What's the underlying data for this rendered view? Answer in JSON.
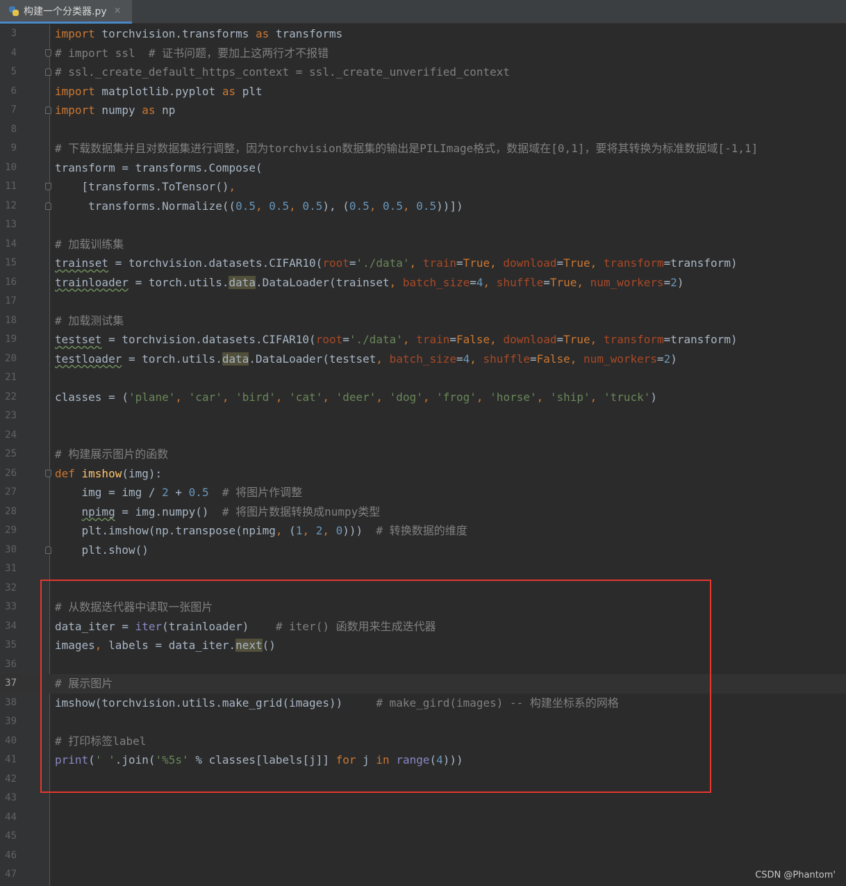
{
  "tab": {
    "label": "构建一个分类器.py",
    "close": "×"
  },
  "editor": {
    "current_line": "37",
    "lines": [
      {
        "n": "3",
        "f": "",
        "t": [
          [
            "kw",
            "import"
          ],
          [
            "",
            " torchvision.transforms "
          ],
          [
            "kw",
            "as"
          ],
          [
            "",
            " transforms"
          ]
        ]
      },
      {
        "n": "4",
        "f": "s",
        "t": [
          [
            "cm",
            "# import ssl  # 证书问题，要加上这两行才不报错"
          ]
        ]
      },
      {
        "n": "5",
        "f": "e",
        "t": [
          [
            "cm",
            "# ssl._create_default_https_context = ssl._create_unverified_context"
          ]
        ]
      },
      {
        "n": "6",
        "f": "",
        "t": [
          [
            "kw",
            "import"
          ],
          [
            "",
            " matplotlib.pyplot "
          ],
          [
            "kw",
            "as"
          ],
          [
            "",
            " plt"
          ]
        ]
      },
      {
        "n": "7",
        "f": "e",
        "t": [
          [
            "kw",
            "import"
          ],
          [
            "",
            " numpy "
          ],
          [
            "kw",
            "as"
          ],
          [
            "",
            " np"
          ]
        ]
      },
      {
        "n": "8",
        "f": "",
        "t": []
      },
      {
        "n": "9",
        "f": "",
        "t": [
          [
            "cm",
            "# 下载数据集并且对数据集进行调整，因为torchvision数据集的输出是PILImage格式，数据域在[0,1]，要将其转换为标准数据域[-1,1]"
          ]
        ]
      },
      {
        "n": "10",
        "f": "",
        "t": [
          [
            "",
            "transform = transforms.Compose("
          ]
        ]
      },
      {
        "n": "11",
        "f": "s",
        "t": [
          [
            "",
            "    [transforms.ToTensor()"
          ],
          [
            "kwc",
            ","
          ]
        ]
      },
      {
        "n": "12",
        "f": "e",
        "t": [
          [
            "",
            "     transforms.Normalize(("
          ],
          [
            "num",
            "0.5"
          ],
          [
            "kwc",
            ", "
          ],
          [
            "num",
            "0.5"
          ],
          [
            "kwc",
            ", "
          ],
          [
            "num",
            "0.5"
          ],
          [
            "",
            "), ("
          ],
          [
            "num",
            "0.5"
          ],
          [
            "kwc",
            ", "
          ],
          [
            "num",
            "0.5"
          ],
          [
            "kwc",
            ", "
          ],
          [
            "num",
            "0.5"
          ],
          [
            "",
            "))])"
          ]
        ]
      },
      {
        "n": "13",
        "f": "",
        "t": []
      },
      {
        "n": "14",
        "f": "",
        "t": [
          [
            "cm",
            "# 加载训练集"
          ]
        ]
      },
      {
        "n": "15",
        "f": "",
        "t": [
          [
            "wavy",
            "trainset"
          ],
          [
            "",
            " = torchvision.datasets.CIFAR10("
          ],
          [
            "param",
            "root"
          ],
          [
            "",
            "="
          ],
          [
            "str",
            "'./data'"
          ],
          [
            "kwc",
            ", "
          ],
          [
            "param",
            "train"
          ],
          [
            "",
            "="
          ],
          [
            "kw",
            "True"
          ],
          [
            "kwc",
            ", "
          ],
          [
            "param",
            "download"
          ],
          [
            "",
            "="
          ],
          [
            "kw",
            "True"
          ],
          [
            "kwc",
            ", "
          ],
          [
            "param",
            "transform"
          ],
          [
            "",
            "=transform)"
          ]
        ]
      },
      {
        "n": "16",
        "f": "",
        "t": [
          [
            "wavy",
            "trainloader"
          ],
          [
            "",
            " = torch.utils."
          ],
          [
            "hl",
            "data"
          ],
          [
            "",
            ".DataLoader(trainset"
          ],
          [
            "kwc",
            ", "
          ],
          [
            "param",
            "batch_size"
          ],
          [
            "",
            "="
          ],
          [
            "num",
            "4"
          ],
          [
            "kwc",
            ", "
          ],
          [
            "param",
            "shuffle"
          ],
          [
            "",
            "="
          ],
          [
            "kw",
            "True"
          ],
          [
            "kwc",
            ", "
          ],
          [
            "param",
            "num_workers"
          ],
          [
            "",
            "="
          ],
          [
            "num",
            "2"
          ],
          [
            "",
            ")"
          ]
        ]
      },
      {
        "n": "17",
        "f": "",
        "t": []
      },
      {
        "n": "18",
        "f": "",
        "t": [
          [
            "cm",
            "# 加载测试集"
          ]
        ]
      },
      {
        "n": "19",
        "f": "",
        "t": [
          [
            "wavy",
            "testset"
          ],
          [
            "",
            " = torchvision.datasets.CIFAR10("
          ],
          [
            "param",
            "root"
          ],
          [
            "",
            "="
          ],
          [
            "str",
            "'./data'"
          ],
          [
            "kwc",
            ", "
          ],
          [
            "param",
            "train"
          ],
          [
            "",
            "="
          ],
          [
            "kw",
            "False"
          ],
          [
            "kwc",
            ", "
          ],
          [
            "param",
            "download"
          ],
          [
            "",
            "="
          ],
          [
            "kw",
            "True"
          ],
          [
            "kwc",
            ", "
          ],
          [
            "param",
            "transform"
          ],
          [
            "",
            "=transform)"
          ]
        ]
      },
      {
        "n": "20",
        "f": "",
        "t": [
          [
            "wavy",
            "testloader"
          ],
          [
            "",
            " = torch.utils."
          ],
          [
            "hl",
            "data"
          ],
          [
            "",
            ".DataLoader(testset"
          ],
          [
            "kwc",
            ", "
          ],
          [
            "param",
            "batch_size"
          ],
          [
            "",
            "="
          ],
          [
            "num",
            "4"
          ],
          [
            "kwc",
            ", "
          ],
          [
            "param",
            "shuffle"
          ],
          [
            "",
            "="
          ],
          [
            "kw",
            "False"
          ],
          [
            "kwc",
            ", "
          ],
          [
            "param",
            "num_workers"
          ],
          [
            "",
            "="
          ],
          [
            "num",
            "2"
          ],
          [
            "",
            ")"
          ]
        ]
      },
      {
        "n": "21",
        "f": "",
        "t": []
      },
      {
        "n": "22",
        "f": "",
        "t": [
          [
            "",
            "classes = ("
          ],
          [
            "str",
            "'plane'"
          ],
          [
            "kwc",
            ", "
          ],
          [
            "str",
            "'car'"
          ],
          [
            "kwc",
            ", "
          ],
          [
            "str",
            "'bird'"
          ],
          [
            "kwc",
            ", "
          ],
          [
            "str",
            "'cat'"
          ],
          [
            "kwc",
            ", "
          ],
          [
            "str",
            "'deer'"
          ],
          [
            "kwc",
            ", "
          ],
          [
            "str",
            "'dog'"
          ],
          [
            "kwc",
            ", "
          ],
          [
            "str",
            "'frog'"
          ],
          [
            "kwc",
            ", "
          ],
          [
            "str",
            "'horse'"
          ],
          [
            "kwc",
            ", "
          ],
          [
            "str",
            "'ship'"
          ],
          [
            "kwc",
            ", "
          ],
          [
            "str",
            "'truck'"
          ],
          [
            "",
            ")"
          ]
        ]
      },
      {
        "n": "23",
        "f": "",
        "t": []
      },
      {
        "n": "24",
        "f": "",
        "t": []
      },
      {
        "n": "25",
        "f": "",
        "t": [
          [
            "cm",
            "# 构建展示图片的函数"
          ]
        ]
      },
      {
        "n": "26",
        "f": "s",
        "t": [
          [
            "kw",
            "def "
          ],
          [
            "fn",
            "imshow"
          ],
          [
            "",
            "(img):"
          ]
        ]
      },
      {
        "n": "27",
        "f": "",
        "t": [
          [
            "",
            "    img = img / "
          ],
          [
            "num",
            "2"
          ],
          [
            "",
            " + "
          ],
          [
            "num",
            "0.5"
          ],
          [
            "",
            "  "
          ],
          [
            "cm",
            "# 将图片作调整"
          ]
        ]
      },
      {
        "n": "28",
        "f": "",
        "t": [
          [
            "",
            "    "
          ],
          [
            "wavy",
            "npimg"
          ],
          [
            "",
            " = img.numpy()  "
          ],
          [
            "cm",
            "# 将图片数据转换成numpy类型"
          ]
        ]
      },
      {
        "n": "29",
        "f": "",
        "t": [
          [
            "",
            "    plt.imshow(np.transpose(npimg"
          ],
          [
            "kwc",
            ", "
          ],
          [
            "",
            "("
          ],
          [
            "num",
            "1"
          ],
          [
            "kwc",
            ", "
          ],
          [
            "num",
            "2"
          ],
          [
            "kwc",
            ", "
          ],
          [
            "num",
            "0"
          ],
          [
            "",
            ")))  "
          ],
          [
            "cm",
            "# 转换数据的维度"
          ]
        ]
      },
      {
        "n": "30",
        "f": "e",
        "t": [
          [
            "",
            "    plt.show()"
          ]
        ]
      },
      {
        "n": "31",
        "f": "",
        "t": []
      },
      {
        "n": "32",
        "f": "",
        "t": []
      },
      {
        "n": "33",
        "f": "",
        "t": [
          [
            "cm",
            "# 从数据迭代器中读取一张图片"
          ]
        ]
      },
      {
        "n": "34",
        "f": "",
        "t": [
          [
            "",
            "data_iter = "
          ],
          [
            "builtin",
            "iter"
          ],
          [
            "",
            "(trainloader)    "
          ],
          [
            "cm",
            "# iter() 函数用来生成迭代器"
          ]
        ]
      },
      {
        "n": "35",
        "f": "",
        "t": [
          [
            "",
            "images"
          ],
          [
            "kwc",
            ", "
          ],
          [
            "",
            "labels = data_iter."
          ],
          [
            "hl",
            "next"
          ],
          [
            "",
            "()"
          ]
        ]
      },
      {
        "n": "36",
        "f": "",
        "t": []
      },
      {
        "n": "37",
        "f": "",
        "t": [
          [
            "cm",
            "# 展示图片"
          ]
        ]
      },
      {
        "n": "38",
        "f": "",
        "t": [
          [
            "",
            "imshow(torchvision.utils.make_grid(images))     "
          ],
          [
            "cm",
            "# make_gird(images) -- 构建坐标系的网格"
          ]
        ]
      },
      {
        "n": "39",
        "f": "",
        "t": []
      },
      {
        "n": "40",
        "f": "",
        "t": [
          [
            "cm",
            "# 打印标签label"
          ]
        ]
      },
      {
        "n": "41",
        "f": "",
        "t": [
          [
            "builtin",
            "print"
          ],
          [
            "",
            "("
          ],
          [
            "str",
            "' '"
          ],
          [
            "",
            ".join("
          ],
          [
            "str",
            "'%5s'"
          ],
          [
            "",
            " % classes[labels[j]] "
          ],
          [
            "kw",
            "for"
          ],
          [
            "",
            " j "
          ],
          [
            "kw",
            "in"
          ],
          [
            "",
            " "
          ],
          [
            "builtin",
            "range"
          ],
          [
            "",
            "("
          ],
          [
            "num",
            "4"
          ],
          [
            "",
            ")))"
          ]
        ]
      },
      {
        "n": "42",
        "f": "",
        "t": []
      },
      {
        "n": "43",
        "f": "",
        "t": []
      },
      {
        "n": "44",
        "f": "",
        "t": []
      },
      {
        "n": "45",
        "f": "",
        "t": []
      },
      {
        "n": "46",
        "f": "",
        "t": []
      },
      {
        "n": "47",
        "f": "",
        "t": []
      }
    ]
  },
  "watermark": "CSDN @Phantom'"
}
